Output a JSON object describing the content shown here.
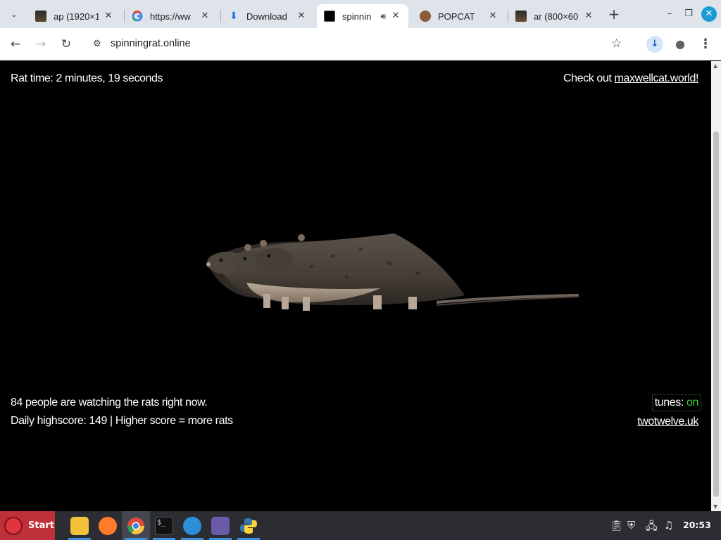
{
  "browser": {
    "tabs": [
      {
        "title": "ap (1920×1",
        "favicon": "image-thumb-icon"
      },
      {
        "title": "https://ww",
        "favicon": "google-icon"
      },
      {
        "title": "Download",
        "favicon": "download-icon"
      },
      {
        "title": "spinnin",
        "favicon": "rat-thumb-icon",
        "audio": true,
        "active": true
      },
      {
        "title": "POPCAT",
        "favicon": "popcat-icon"
      },
      {
        "title": "ar (800×60",
        "favicon": "image-thumb-icon"
      }
    ],
    "url": "spinningrat.online",
    "accent": "#1a9bd7"
  },
  "page": {
    "rat_time": "Rat time: 2 minutes, 19 seconds",
    "check_out_prefix": "Check out ",
    "check_out_link": "maxwellcat.world!",
    "watchers": "84 people are watching the rats right now.",
    "highscore": "Daily highscore: 149 | Higher score = more rats",
    "tunes_label": "tunes: ",
    "tunes_state": "on",
    "tunes_color": "#3ccf3c",
    "credit_link": "twotwelve.uk"
  },
  "taskbar": {
    "start_label": "Start",
    "apps": [
      "files-icon",
      "firefox-icon",
      "chrome-icon",
      "terminal-icon",
      "settings-icon",
      "app-grid-icon",
      "python-icon"
    ],
    "clock": "20:53"
  }
}
